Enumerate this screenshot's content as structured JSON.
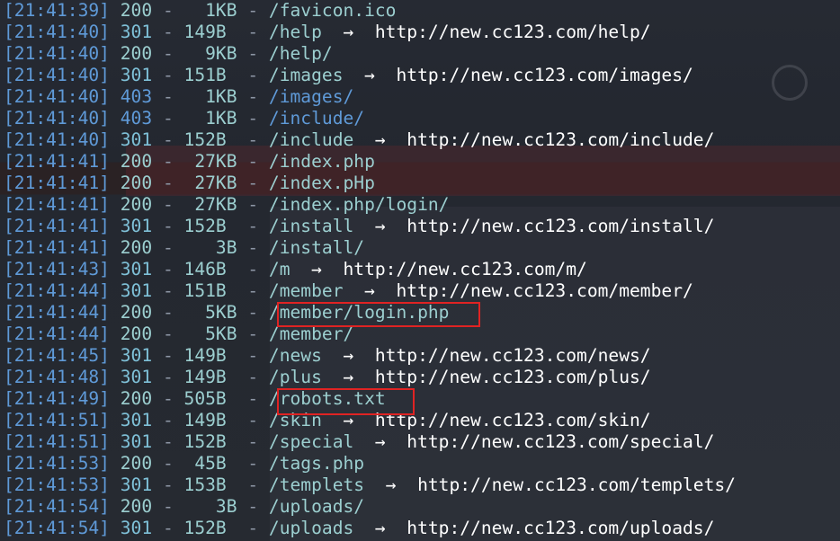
{
  "terminal": {
    "arrow_glyph": "→",
    "lines": [
      {
        "time": "[21:41:39]",
        "status": "200",
        "size": "  1KB",
        "path": "/favicon.ico",
        "target": ""
      },
      {
        "time": "[21:41:40]",
        "status": "301",
        "size": "149B ",
        "path": "/help",
        "target": "http://new.cc123.com/help/"
      },
      {
        "time": "[21:41:40]",
        "status": "200",
        "size": "  9KB",
        "path": "/help/",
        "target": ""
      },
      {
        "time": "[21:41:40]",
        "status": "301",
        "size": "151B ",
        "path": "/images",
        "target": "http://new.cc123.com/images/"
      },
      {
        "time": "[21:41:40]",
        "status": "403",
        "size": "  1KB",
        "path": "/images/",
        "target": ""
      },
      {
        "time": "[21:41:40]",
        "status": "403",
        "size": "  1KB",
        "path": "/include/",
        "target": ""
      },
      {
        "time": "[21:41:40]",
        "status": "301",
        "size": "152B ",
        "path": "/include",
        "target": "http://new.cc123.com/include/"
      },
      {
        "time": "[21:41:41]",
        "status": "200",
        "size": " 27KB",
        "path": "/index.php",
        "target": ""
      },
      {
        "time": "[21:41:41]",
        "status": "200",
        "size": " 27KB",
        "path": "/index.pHp",
        "target": ""
      },
      {
        "time": "[21:41:41]",
        "status": "200",
        "size": " 27KB",
        "path": "/index.php/login/",
        "target": ""
      },
      {
        "time": "[21:41:41]",
        "status": "301",
        "size": "152B ",
        "path": "/install",
        "target": "http://new.cc123.com/install/"
      },
      {
        "time": "[21:41:41]",
        "status": "200",
        "size": "   3B",
        "path": "/install/",
        "target": ""
      },
      {
        "time": "[21:41:43]",
        "status": "301",
        "size": "146B ",
        "path": "/m",
        "target": "http://new.cc123.com/m/"
      },
      {
        "time": "[21:41:44]",
        "status": "301",
        "size": "151B ",
        "path": "/member",
        "target": "http://new.cc123.com/member/"
      },
      {
        "time": "[21:41:44]",
        "status": "200",
        "size": "  5KB",
        "path": "/member/login.php",
        "target": ""
      },
      {
        "time": "[21:41:44]",
        "status": "200",
        "size": "  5KB",
        "path": "/member/",
        "target": ""
      },
      {
        "time": "[21:41:45]",
        "status": "301",
        "size": "149B ",
        "path": "/news",
        "target": "http://new.cc123.com/news/"
      },
      {
        "time": "[21:41:48]",
        "status": "301",
        "size": "149B ",
        "path": "/plus",
        "target": "http://new.cc123.com/plus/"
      },
      {
        "time": "[21:41:49]",
        "status": "200",
        "size": "505B ",
        "path": "/robots.txt",
        "target": ""
      },
      {
        "time": "[21:41:51]",
        "status": "301",
        "size": "149B ",
        "path": "/skin",
        "target": "http://new.cc123.com/skin/"
      },
      {
        "time": "[21:41:51]",
        "status": "301",
        "size": "152B ",
        "path": "/special",
        "target": "http://new.cc123.com/special/"
      },
      {
        "time": "[21:41:53]",
        "status": "200",
        "size": " 45B ",
        "path": "/tags.php",
        "target": ""
      },
      {
        "time": "[21:41:53]",
        "status": "301",
        "size": "153B ",
        "path": "/templets",
        "target": "http://new.cc123.com/templets/"
      },
      {
        "time": "[21:41:54]",
        "status": "200",
        "size": "   3B",
        "path": "/uploads/",
        "target": ""
      },
      {
        "time": "[21:41:54]",
        "status": "301",
        "size": "152B ",
        "path": "/uploads",
        "target": "http://new.cc123.com/uploads/"
      }
    ]
  },
  "colors": {
    "background": "#23272f",
    "timestamp": "#5f9ad8",
    "ok_text": "#9ccfd0",
    "forbidden_text": "#5f9ad8",
    "redirect_target": "#ffffff",
    "highlight_box": "#e02323"
  }
}
